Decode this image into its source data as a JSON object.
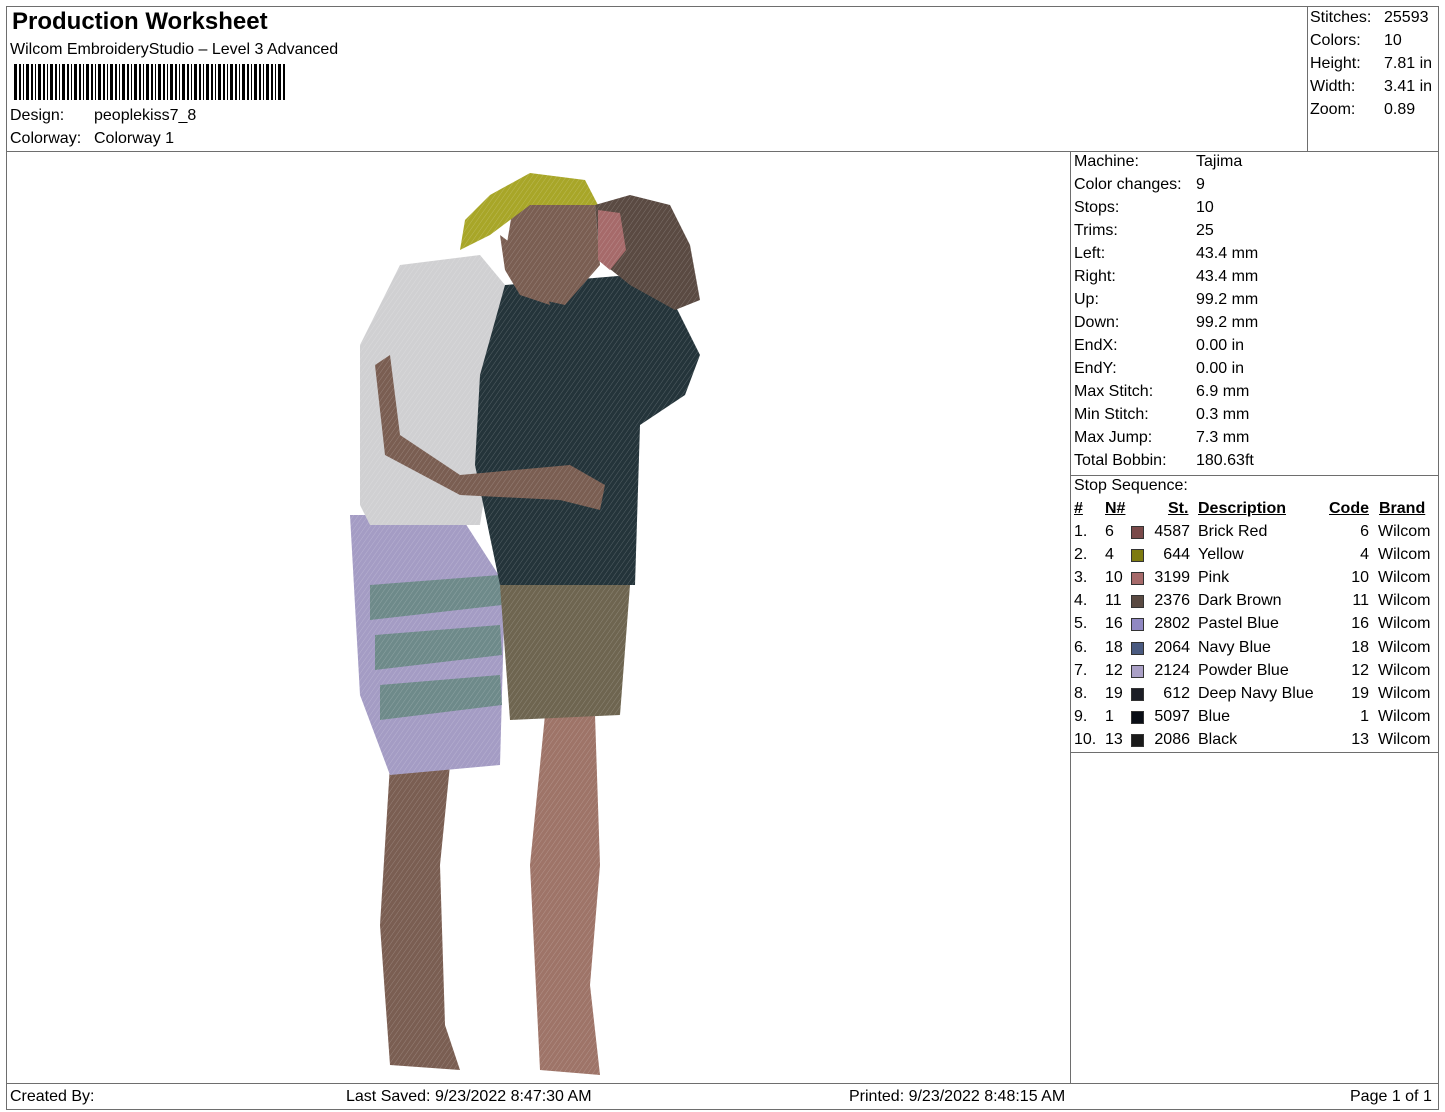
{
  "header": {
    "title": "Production Worksheet",
    "software": "Wilcom EmbroideryStudio – Level 3 Advanced",
    "design_label": "Design:",
    "design_value": "peoplekiss7_8",
    "colorway_label": "Colorway:",
    "colorway_value": "Colorway 1"
  },
  "summary": [
    {
      "label": "Stitches:",
      "value": "25593"
    },
    {
      "label": "Colors:",
      "value": "10"
    },
    {
      "label": "Height:",
      "value": "7.81 in"
    },
    {
      "label": "Width:",
      "value": "3.41 in"
    },
    {
      "label": "Zoom:",
      "value": "0.89"
    }
  ],
  "machine_info": [
    {
      "label": "Machine:",
      "value": "Tajima"
    },
    {
      "label": "Color changes:",
      "value": "9"
    },
    {
      "label": "Stops:",
      "value": "10"
    },
    {
      "label": "Trims:",
      "value": "25"
    },
    {
      "label": "Left:",
      "value": "43.4 mm"
    },
    {
      "label": "Right:",
      "value": "43.4 mm"
    },
    {
      "label": "Up:",
      "value": "99.2 mm"
    },
    {
      "label": "Down:",
      "value": "99.2 mm"
    },
    {
      "label": "EndX:",
      "value": "0.00 in"
    },
    {
      "label": "EndY:",
      "value": "0.00 in"
    },
    {
      "label": "Max Stitch:",
      "value": "6.9 mm"
    },
    {
      "label": "Min Stitch:",
      "value": "0.3 mm"
    },
    {
      "label": "Max Jump:",
      "value": "7.3 mm"
    },
    {
      "label": "Total Bobbin:",
      "value": "180.63ft"
    }
  ],
  "stop_sequence": {
    "title": "Stop Sequence:",
    "columns": {
      "num": "#",
      "n": "N#",
      "st": "St.",
      "description": "Description",
      "code": "Code",
      "brand": "Brand"
    },
    "rows": [
      {
        "num": "1.",
        "n": "6",
        "st": "4587",
        "description": "Brick Red",
        "code": "6",
        "brand": "Wilcom",
        "color": "#7a4a4a"
      },
      {
        "num": "2.",
        "n": "4",
        "st": "644",
        "description": "Yellow",
        "code": "4",
        "brand": "Wilcom",
        "color": "#7d7a10"
      },
      {
        "num": "3.",
        "n": "10",
        "st": "3199",
        "description": "Pink",
        "code": "10",
        "brand": "Wilcom",
        "color": "#a66a6a"
      },
      {
        "num": "4.",
        "n": "11",
        "st": "2376",
        "description": "Dark Brown",
        "code": "11",
        "brand": "Wilcom",
        "color": "#5a4a42"
      },
      {
        "num": "5.",
        "n": "16",
        "st": "2802",
        "description": "Pastel Blue",
        "code": "16",
        "brand": "Wilcom",
        "color": "#9088c2"
      },
      {
        "num": "6.",
        "n": "18",
        "st": "2064",
        "description": "Navy Blue",
        "code": "18",
        "brand": "Wilcom",
        "color": "#4a5a80"
      },
      {
        "num": "7.",
        "n": "12",
        "st": "2124",
        "description": "Powder Blue",
        "code": "12",
        "brand": "Wilcom",
        "color": "#aaa0c6"
      },
      {
        "num": "8.",
        "n": "19",
        "st": "612",
        "description": "Deep Navy Blue",
        "code": "19",
        "brand": "Wilcom",
        "color": "#1c1e26"
      },
      {
        "num": "9.",
        "n": "1",
        "st": "5097",
        "description": "Blue",
        "code": "1",
        "brand": "Wilcom",
        "color": "#0a0e16"
      },
      {
        "num": "10.",
        "n": "13",
        "st": "2086",
        "description": "Black",
        "code": "13",
        "brand": "Wilcom",
        "color": "#1a1a1a"
      }
    ]
  },
  "footer": {
    "created_by": "Created By:",
    "last_saved": "Last Saved: 9/23/2022 8:47:30 AM",
    "printed": "Printed: 9/23/2022 8:48:15 AM",
    "page": "Page 1 of 1"
  }
}
